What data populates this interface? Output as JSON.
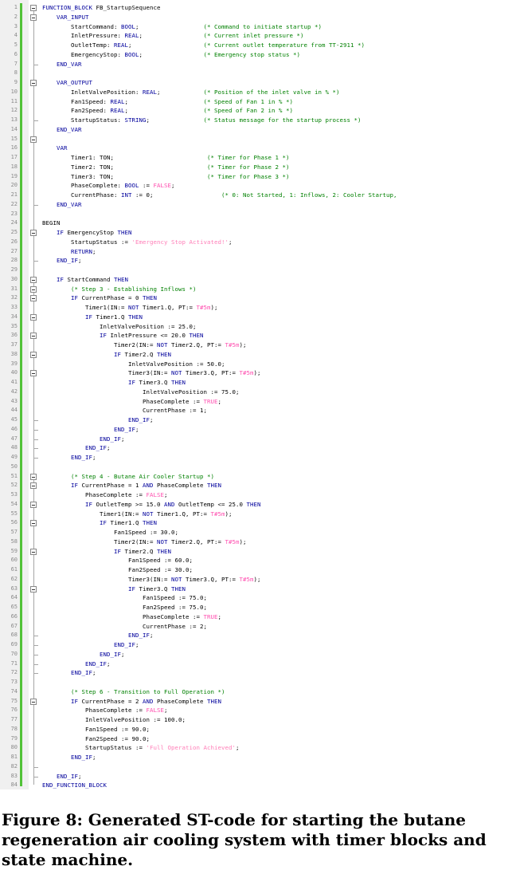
{
  "caption": "Figure 8: Generated ST-code for starting the butane regeneration air cooling system with timer blocks and state machine.",
  "line_count": 84,
  "fold_markers": [
    1,
    2,
    9,
    15,
    25,
    30,
    31,
    32,
    34,
    36,
    38,
    40,
    51,
    52,
    54,
    56,
    59,
    63,
    75
  ],
  "fold_ends": [
    7,
    13,
    22,
    28,
    45,
    46,
    47,
    48,
    49,
    68,
    69,
    70,
    71,
    72,
    82,
    83
  ],
  "code": [
    [
      [
        "k",
        "FUNCTION_BLOCK"
      ],
      [
        "t",
        " FB_StartupSequence"
      ]
    ],
    [
      [
        "t",
        "    "
      ],
      [
        "k",
        "VAR_INPUT"
      ]
    ],
    [
      [
        "t",
        "        StartCommand: "
      ],
      [
        "k",
        "BOOL"
      ],
      [
        "t",
        ";                  "
      ],
      [
        "c",
        "(* Command to initiate startup *)"
      ]
    ],
    [
      [
        "t",
        "        InletPressure: "
      ],
      [
        "k",
        "REAL"
      ],
      [
        "t",
        ";                 "
      ],
      [
        "c",
        "(* Current inlet pressure *)"
      ]
    ],
    [
      [
        "t",
        "        OutletTemp: "
      ],
      [
        "k",
        "REAL"
      ],
      [
        "t",
        ";                    "
      ],
      [
        "c",
        "(* Current outlet temperature from TT-2911 *)"
      ]
    ],
    [
      [
        "t",
        "        EmergencyStop: "
      ],
      [
        "k",
        "BOOL"
      ],
      [
        "t",
        ";                 "
      ],
      [
        "c",
        "(* Emergency stop status *)"
      ]
    ],
    [
      [
        "t",
        "    "
      ],
      [
        "k",
        "END_VAR"
      ]
    ],
    [],
    [
      [
        "t",
        "    "
      ],
      [
        "k",
        "VAR_OUTPUT"
      ]
    ],
    [
      [
        "t",
        "        InletValvePosition: "
      ],
      [
        "k",
        "REAL"
      ],
      [
        "t",
        ";            "
      ],
      [
        "c",
        "(* Position of the inlet valve in % *)"
      ]
    ],
    [
      [
        "t",
        "        Fan1Speed: "
      ],
      [
        "k",
        "REAL"
      ],
      [
        "t",
        ";                     "
      ],
      [
        "c",
        "(* Speed of Fan 1 in % *)"
      ]
    ],
    [
      [
        "t",
        "        Fan2Speed: "
      ],
      [
        "k",
        "REAL"
      ],
      [
        "t",
        ";                     "
      ],
      [
        "c",
        "(* Speed of Fan 2 in % *)"
      ]
    ],
    [
      [
        "t",
        "        StartupStatus: "
      ],
      [
        "k",
        "STRING"
      ],
      [
        "t",
        ";               "
      ],
      [
        "c",
        "(* Status message for the startup process *)"
      ]
    ],
    [
      [
        "t",
        "    "
      ],
      [
        "k",
        "END_VAR"
      ]
    ],
    [],
    [
      [
        "t",
        "    "
      ],
      [
        "k",
        "VAR"
      ]
    ],
    [
      [
        "t",
        "        Timer1: TON;                          "
      ],
      [
        "c",
        "(* Timer for Phase 1 *)"
      ]
    ],
    [
      [
        "t",
        "        Timer2: TON;                          "
      ],
      [
        "c",
        "(* Timer for Phase 2 *)"
      ]
    ],
    [
      [
        "t",
        "        Timer3: TON;                          "
      ],
      [
        "c",
        "(* Timer for Phase 3 *)"
      ]
    ],
    [
      [
        "t",
        "        PhaseComplete: "
      ],
      [
        "k",
        "BOOL"
      ],
      [
        "t",
        " := "
      ],
      [
        "s",
        "FALSE"
      ],
      [
        "t",
        ";"
      ]
    ],
    [
      [
        "t",
        "        CurrentPhase: "
      ],
      [
        "k",
        "INT"
      ],
      [
        "t",
        " := 0;                   "
      ],
      [
        "c",
        "(* 0: Not Started, 1: Inflows, 2: Cooler Startup,"
      ]
    ],
    [
      [
        "t",
        "    "
      ],
      [
        "k",
        "END_VAR"
      ]
    ],
    [],
    [
      [
        "t",
        "BEGIN"
      ]
    ],
    [
      [
        "t",
        "    "
      ],
      [
        "k",
        "IF"
      ],
      [
        "t",
        " EmergencyStop "
      ],
      [
        "k",
        "THEN"
      ]
    ],
    [
      [
        "t",
        "        StartupStatus := "
      ],
      [
        "str",
        "'Emergency Stop Activated!'"
      ],
      [
        "t",
        ";"
      ]
    ],
    [
      [
        "t",
        "        "
      ],
      [
        "k",
        "RETURN"
      ],
      [
        "t",
        ";"
      ]
    ],
    [
      [
        "t",
        "    "
      ],
      [
        "k",
        "END_IF"
      ],
      [
        "t",
        ";"
      ]
    ],
    [],
    [
      [
        "t",
        "    "
      ],
      [
        "k",
        "IF"
      ],
      [
        "t",
        " StartCommand "
      ],
      [
        "k",
        "THEN"
      ]
    ],
    [
      [
        "t",
        "        "
      ],
      [
        "c",
        "(* Step 3 - Establishing Inflows *)"
      ]
    ],
    [
      [
        "t",
        "        "
      ],
      [
        "k",
        "IF"
      ],
      [
        "t",
        " CurrentPhase = 0 "
      ],
      [
        "k",
        "THEN"
      ]
    ],
    [
      [
        "t",
        "            Timer1(IN:= "
      ],
      [
        "k",
        "NOT"
      ],
      [
        "t",
        " Timer1.Q, PT:= "
      ],
      [
        "s",
        "T#5m"
      ],
      [
        "t",
        ");"
      ]
    ],
    [
      [
        "t",
        "            "
      ],
      [
        "k",
        "IF"
      ],
      [
        "t",
        " Timer1.Q "
      ],
      [
        "k",
        "THEN"
      ]
    ],
    [
      [
        "t",
        "                InletValvePosition := 25.0;"
      ]
    ],
    [
      [
        "t",
        "                "
      ],
      [
        "k",
        "IF"
      ],
      [
        "t",
        " InletPressure <= 20.0 "
      ],
      [
        "k",
        "THEN"
      ]
    ],
    [
      [
        "t",
        "                    Timer2(IN:= "
      ],
      [
        "k",
        "NOT"
      ],
      [
        "t",
        " Timer2.Q, PT:= "
      ],
      [
        "s",
        "T#5m"
      ],
      [
        "t",
        ");"
      ]
    ],
    [
      [
        "t",
        "                    "
      ],
      [
        "k",
        "IF"
      ],
      [
        "t",
        " Timer2.Q "
      ],
      [
        "k",
        "THEN"
      ]
    ],
    [
      [
        "t",
        "                        InletValvePosition := 50.0;"
      ]
    ],
    [
      [
        "t",
        "                        Timer3(IN:= "
      ],
      [
        "k",
        "NOT"
      ],
      [
        "t",
        " Timer3.Q, PT:= "
      ],
      [
        "s",
        "T#5m"
      ],
      [
        "t",
        ");"
      ]
    ],
    [
      [
        "t",
        "                        "
      ],
      [
        "k",
        "IF"
      ],
      [
        "t",
        " Timer3.Q "
      ],
      [
        "k",
        "THEN"
      ]
    ],
    [
      [
        "t",
        "                            InletValvePosition := 75.0;"
      ]
    ],
    [
      [
        "t",
        "                            PhaseComplete := "
      ],
      [
        "s",
        "TRUE"
      ],
      [
        "t",
        ";"
      ]
    ],
    [
      [
        "t",
        "                            CurrentPhase := 1;"
      ]
    ],
    [
      [
        "t",
        "                        "
      ],
      [
        "k",
        "END_IF"
      ],
      [
        "t",
        ";"
      ]
    ],
    [
      [
        "t",
        "                    "
      ],
      [
        "k",
        "END_IF"
      ],
      [
        "t",
        ";"
      ]
    ],
    [
      [
        "t",
        "                "
      ],
      [
        "k",
        "END_IF"
      ],
      [
        "t",
        ";"
      ]
    ],
    [
      [
        "t",
        "            "
      ],
      [
        "k",
        "END_IF"
      ],
      [
        "t",
        ";"
      ]
    ],
    [
      [
        "t",
        "        "
      ],
      [
        "k",
        "END_IF"
      ],
      [
        "t",
        ";"
      ]
    ],
    [],
    [
      [
        "t",
        "        "
      ],
      [
        "c",
        "(* Step 4 - Butane Air Cooler Startup *)"
      ]
    ],
    [
      [
        "t",
        "        "
      ],
      [
        "k",
        "IF"
      ],
      [
        "t",
        " CurrentPhase = 1 "
      ],
      [
        "k",
        "AND"
      ],
      [
        "t",
        " PhaseComplete "
      ],
      [
        "k",
        "THEN"
      ]
    ],
    [
      [
        "t",
        "            PhaseComplete := "
      ],
      [
        "s",
        "FALSE"
      ],
      [
        "t",
        ";"
      ]
    ],
    [
      [
        "t",
        "            "
      ],
      [
        "k",
        "IF"
      ],
      [
        "t",
        " OutletTemp >= 15.0 "
      ],
      [
        "k",
        "AND"
      ],
      [
        "t",
        " OutletTemp <= 25.0 "
      ],
      [
        "k",
        "THEN"
      ]
    ],
    [
      [
        "t",
        "                Timer1(IN:= "
      ],
      [
        "k",
        "NOT"
      ],
      [
        "t",
        " Timer1.Q, PT:= "
      ],
      [
        "s",
        "T#5m"
      ],
      [
        "t",
        ");"
      ]
    ],
    [
      [
        "t",
        "                "
      ],
      [
        "k",
        "IF"
      ],
      [
        "t",
        " Timer1.Q "
      ],
      [
        "k",
        "THEN"
      ]
    ],
    [
      [
        "t",
        "                    Fan1Speed := 30.0;"
      ]
    ],
    [
      [
        "t",
        "                    Timer2(IN:= "
      ],
      [
        "k",
        "NOT"
      ],
      [
        "t",
        " Timer2.Q, PT:= "
      ],
      [
        "s",
        "T#5m"
      ],
      [
        "t",
        ");"
      ]
    ],
    [
      [
        "t",
        "                    "
      ],
      [
        "k",
        "IF"
      ],
      [
        "t",
        " Timer2.Q "
      ],
      [
        "k",
        "THEN"
      ]
    ],
    [
      [
        "t",
        "                        Fan1Speed := 60.0;"
      ]
    ],
    [
      [
        "t",
        "                        Fan2Speed := 30.0;"
      ]
    ],
    [
      [
        "t",
        "                        Timer3(IN:= "
      ],
      [
        "k",
        "NOT"
      ],
      [
        "t",
        " Timer3.Q, PT:= "
      ],
      [
        "s",
        "T#5m"
      ],
      [
        "t",
        ");"
      ]
    ],
    [
      [
        "t",
        "                        "
      ],
      [
        "k",
        "IF"
      ],
      [
        "t",
        " Timer3.Q "
      ],
      [
        "k",
        "THEN"
      ]
    ],
    [
      [
        "t",
        "                            Fan1Speed := 75.0;"
      ]
    ],
    [
      [
        "t",
        "                            Fan2Speed := 75.0;"
      ]
    ],
    [
      [
        "t",
        "                            PhaseComplete := "
      ],
      [
        "s",
        "TRUE"
      ],
      [
        "t",
        ";"
      ]
    ],
    [
      [
        "t",
        "                            CurrentPhase := 2;"
      ]
    ],
    [
      [
        "t",
        "                        "
      ],
      [
        "k",
        "END_IF"
      ],
      [
        "t",
        ";"
      ]
    ],
    [
      [
        "t",
        "                    "
      ],
      [
        "k",
        "END_IF"
      ],
      [
        "t",
        ";"
      ]
    ],
    [
      [
        "t",
        "                "
      ],
      [
        "k",
        "END_IF"
      ],
      [
        "t",
        ";"
      ]
    ],
    [
      [
        "t",
        "            "
      ],
      [
        "k",
        "END_IF"
      ],
      [
        "t",
        ";"
      ]
    ],
    [
      [
        "t",
        "        "
      ],
      [
        "k",
        "END_IF"
      ],
      [
        "t",
        ";"
      ]
    ],
    [],
    [
      [
        "t",
        "        "
      ],
      [
        "c",
        "(* Step 6 - Transition to Full Operation *)"
      ]
    ],
    [
      [
        "t",
        "        "
      ],
      [
        "k",
        "IF"
      ],
      [
        "t",
        " CurrentPhase = 2 "
      ],
      [
        "k",
        "AND"
      ],
      [
        "t",
        " PhaseComplete "
      ],
      [
        "k",
        "THEN"
      ]
    ],
    [
      [
        "t",
        "            PhaseComplete := "
      ],
      [
        "s",
        "FALSE"
      ],
      [
        "t",
        ";"
      ]
    ],
    [
      [
        "t",
        "            InletValvePosition := 100.0;"
      ]
    ],
    [
      [
        "t",
        "            Fan1Speed := 90.0;"
      ]
    ],
    [
      [
        "t",
        "            Fan2Speed := 90.0;"
      ]
    ],
    [
      [
        "t",
        "            StartupStatus := "
      ],
      [
        "str",
        "'Full Operation Achieved'"
      ],
      [
        "t",
        ";"
      ]
    ],
    [
      [
        "t",
        "        "
      ],
      [
        "k",
        "END_IF"
      ],
      [
        "t",
        ";"
      ]
    ],
    [],
    [
      [
        "t",
        "    "
      ],
      [
        "k",
        "END_IF"
      ],
      [
        "t",
        ";"
      ]
    ],
    [
      [
        "k",
        "END_FUNCTION_BLOCK"
      ]
    ]
  ]
}
